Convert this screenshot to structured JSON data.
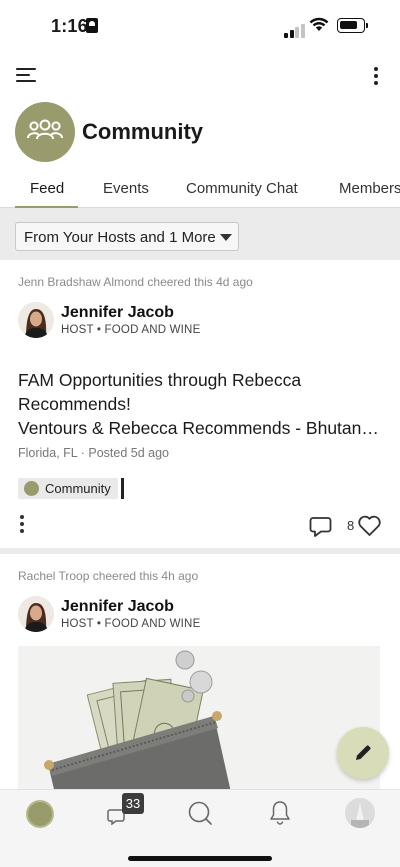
{
  "status_bar": {
    "time": "1:16"
  },
  "community": {
    "title": "Community"
  },
  "tabs": [
    {
      "label": "Feed",
      "active": true
    },
    {
      "label": "Events",
      "active": false
    },
    {
      "label": "Community Chat",
      "active": false
    },
    {
      "label": "Members",
      "active": false
    }
  ],
  "filter": {
    "label": "From Your Hosts and 1 More"
  },
  "posts": [
    {
      "cheered": "Jenn Bradshaw Almond cheered this 4d ago",
      "author": "Jennifer Jacob",
      "meta": "HOST • FOOD AND WINE",
      "title_lines": [
        "FAM Opportunities through Rebecca",
        "Recommends!",
        "Ventours & Rebecca Recommends - Bhutan…"
      ],
      "location_posted": "Florida, FL · Posted 5d ago",
      "tag": "Community",
      "likes": "8"
    },
    {
      "cheered": "Rachel Troop cheered this 4h ago",
      "author": "Jennifer Jacob",
      "meta": "HOST • FOOD AND WINE"
    }
  ],
  "bottom_nav": {
    "messages_badge": "33"
  },
  "colors": {
    "accent": "#9a9b6c",
    "fab": "#d8dcb8",
    "feed_bg": "#ebebeb"
  }
}
